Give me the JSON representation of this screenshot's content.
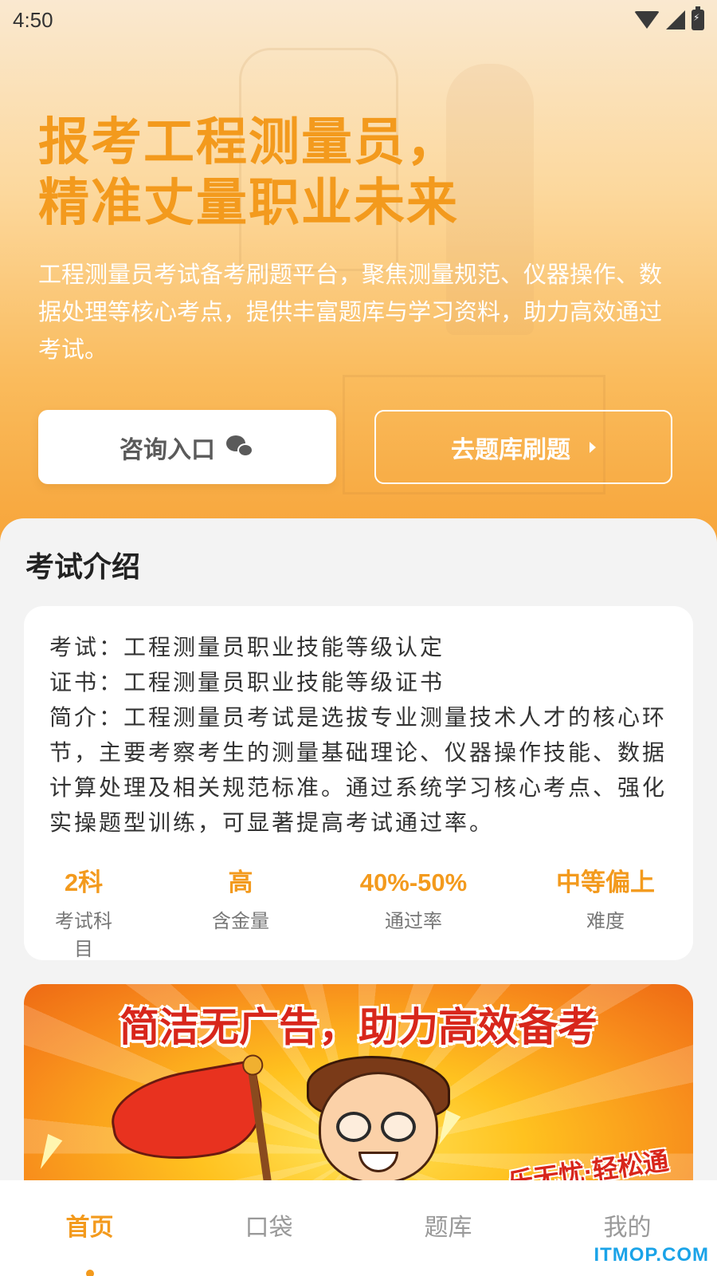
{
  "status_bar": {
    "time": "4:50",
    "icons": [
      "wifi-icon",
      "signal-icon",
      "battery-charging-icon"
    ]
  },
  "hero": {
    "title_line1": "报考工程测量员，",
    "title_line2": "精准丈量职业未来",
    "description": "工程测量员考试备考刷题平台，聚焦测量规范、仪器操作、数据处理等核心考点，提供丰富题库与学习资料，助力高效通过考试。",
    "consult_button": {
      "label": "咨询入口",
      "icon": "wechat-icon"
    },
    "bank_button": {
      "label": "去题库刷题",
      "icon": "chevron-right-icon"
    }
  },
  "intro": {
    "section_title": "考试介绍",
    "exam_line": "考试：工程测量员职业技能等级认定",
    "cert_line": "证书：工程测量员职业技能等级证书",
    "summary_line": "简介：工程测量员考试是选拔专业测量技术人才的核心环节，主要考察考生的测量基础理论、仪器操作技能、数据计算处理及相关规范标准。通过系统学习核心考点、强化实操题型训练，可显著提高考试通过率。",
    "stats": [
      {
        "value": "2科",
        "label": "考试科目"
      },
      {
        "value": "高",
        "label": "含金量"
      },
      {
        "value": "40%-50%",
        "label": "通过率"
      },
      {
        "value": "中等偏上",
        "label": "难度"
      }
    ]
  },
  "promo": {
    "title": "简洁无广告，助力高效备考",
    "slogan": "乐无忧·轻松通关"
  },
  "bottom_nav": {
    "items": [
      {
        "label": "首页",
        "active": true
      },
      {
        "label": "口袋",
        "active": false
      },
      {
        "label": "题库",
        "active": false
      },
      {
        "label": "我的",
        "active": false
      }
    ]
  },
  "watermark": "ITMOP.COM",
  "colors": {
    "accent": "#f39a1d",
    "promo_red": "#d8261b",
    "watermark": "#1aa3e8"
  }
}
